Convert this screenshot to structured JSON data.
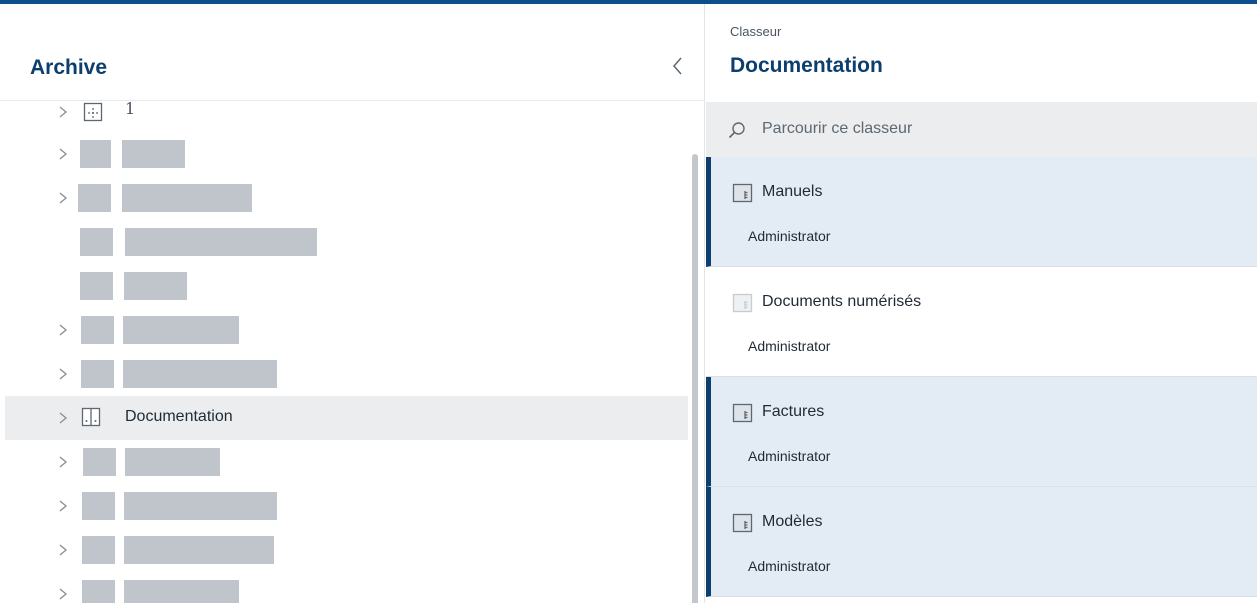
{
  "left_panel": {
    "title": "Archive",
    "collapse_icon": "chevron-left-icon",
    "tree": {
      "first_item_label": "1",
      "selected_item_label": "Documentation",
      "expand_icon": "chevron-right-icon"
    }
  },
  "right_panel": {
    "breadcrumb": "Classeur",
    "title": "Documentation",
    "search": {
      "placeholder": "Parcourir ce classeur",
      "icon": "search-icon"
    },
    "items": [
      {
        "name": "Manuels",
        "owner": "Administrator"
      },
      {
        "name": "Documents numérisés",
        "owner": "Administrator"
      },
      {
        "name": "Factures",
        "owner": "Administrator"
      },
      {
        "name": "Modèles",
        "owner": "Administrator"
      }
    ]
  },
  "colors": {
    "accent": "#0d4f8b",
    "title": "#0d3f6e",
    "highlight_bg": "#e3ecf4",
    "selected_row_bg": "#ebedee",
    "redaction": "#bfc5ca"
  }
}
